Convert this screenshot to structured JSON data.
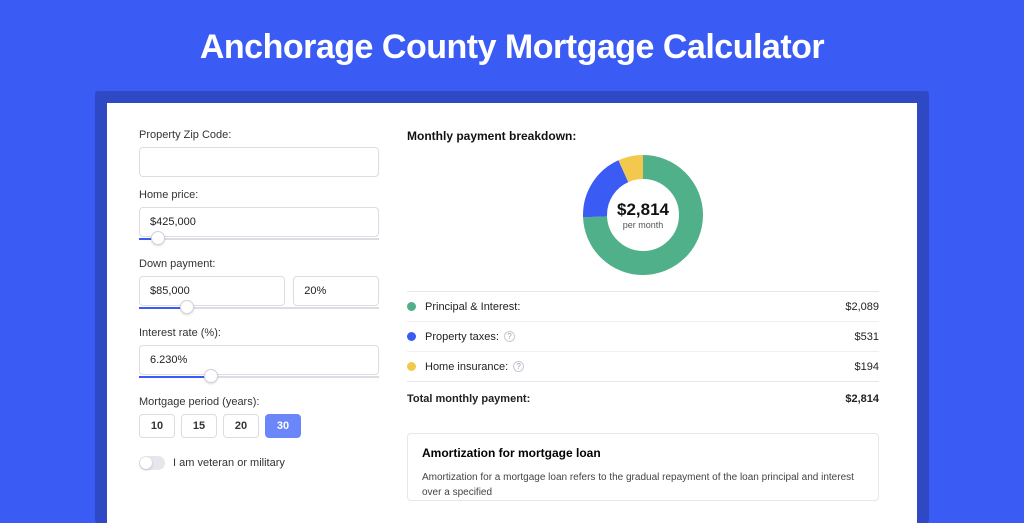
{
  "title": "Anchorage County Mortgage Calculator",
  "colors": {
    "green": "#4fb08a",
    "blue": "#3a5cf5",
    "yellow": "#f2c94c"
  },
  "form": {
    "zip": {
      "label": "Property Zip Code:",
      "value": ""
    },
    "price": {
      "label": "Home price:",
      "value": "$425,000",
      "slider_pct": 8
    },
    "down": {
      "label": "Down payment:",
      "value": "$85,000",
      "pct": "20%",
      "slider_pct": 20
    },
    "rate": {
      "label": "Interest rate (%):",
      "value": "6.230%",
      "slider_pct": 30
    },
    "period": {
      "label": "Mortgage period (years):",
      "options": [
        "10",
        "15",
        "20",
        "30"
      ],
      "selected": "30"
    },
    "veteran": {
      "label": "I am veteran or military",
      "on": false
    }
  },
  "breakdown": {
    "heading": "Monthly payment breakdown:",
    "total_display": "$2,814",
    "per": "per month",
    "items": [
      {
        "key": "pi",
        "label": "Principal & Interest:",
        "amount": "$2,089",
        "color": "#4fb08a",
        "pct": 74.26,
        "help": false
      },
      {
        "key": "tax",
        "label": "Property taxes:",
        "amount": "$531",
        "color": "#3a5cf5",
        "pct": 18.87,
        "help": true
      },
      {
        "key": "ins",
        "label": "Home insurance:",
        "amount": "$194",
        "color": "#f2c94c",
        "pct": 6.87,
        "help": true
      }
    ],
    "total_label": "Total monthly payment:",
    "total_amount": "$2,814"
  },
  "chart_data": {
    "type": "pie",
    "title": "Monthly payment breakdown:",
    "series": [
      {
        "name": "Principal & Interest",
        "value": 2089
      },
      {
        "name": "Property taxes",
        "value": 531
      },
      {
        "name": "Home insurance",
        "value": 194
      }
    ],
    "total": 2814,
    "center_label": "$2,814 per month"
  },
  "amort": {
    "heading": "Amortization for mortgage loan",
    "text": "Amortization for a mortgage loan refers to the gradual repayment of the loan principal and interest over a specified"
  }
}
